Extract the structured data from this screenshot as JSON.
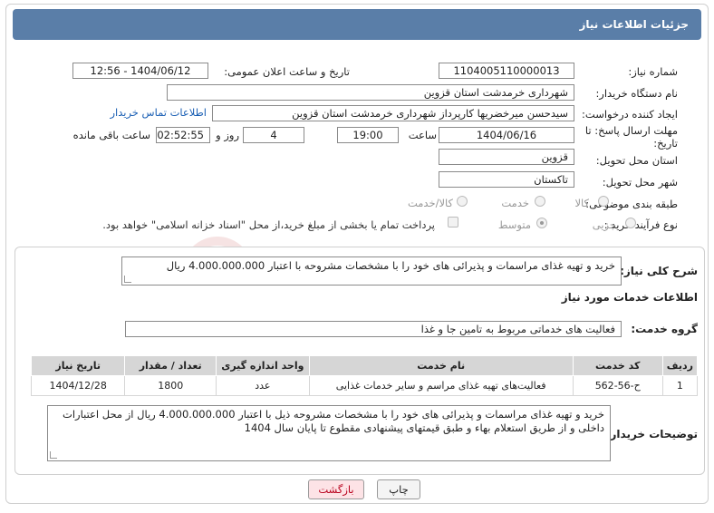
{
  "header": {
    "title": "جزئیات اطلاعات نیاز"
  },
  "fields": {
    "need_number_label": "شماره نیاز:",
    "need_number": "1104005110000013",
    "announce_label": "تاریخ و ساعت اعلان عمومی:",
    "announce_value": "1404/06/12 - 12:56",
    "buyer_org_label": "نام دستگاه خریدار:",
    "buyer_org": "شهرداری خرمدشت استان قزوین",
    "creator_label": "ایجاد کننده درخواست:",
    "creator": "سیدحسن میرخضریها کارپرداز شهرداری خرمدشت استان قزوین",
    "contact_link": "اطلاعات تماس خریدار",
    "deadline_label": "مهلت ارسال پاسخ: تا تاریخ:",
    "deadline_date": "1404/06/16",
    "hour_label": "ساعت",
    "deadline_time": "19:00",
    "days_value": "4",
    "days_label": "روز و",
    "remaining_time": "02:52:55",
    "remaining_label": "ساعت باقی مانده",
    "province_label": "استان محل تحویل:",
    "province": "قزوین",
    "city_label": "شهر محل تحویل:",
    "city": "تاکستان",
    "category_label": "طبقه بندی موضوعی:",
    "category_options": [
      "کالا",
      "خدمت",
      "کالا/خدمت"
    ],
    "process_label": "نوع فرآیند خرید :",
    "process_options": [
      "جزیی",
      "متوسط"
    ],
    "payment_note": "پرداخت تمام یا بخشی از مبلغ خرید،از محل \"اسناد خزانه اسلامی\" خواهد بود."
  },
  "summary": {
    "label": "شرح کلی نیاز:",
    "text": "خرید و تهیه غذای مراسمات و پذیرائی های خود را با مشخصات مشروحه با اعتبار 4.000.000.000 ریال"
  },
  "services": {
    "heading": "اطلاعات خدمات مورد نیاز",
    "group_label": "گروه خدمت:",
    "group_value": "فعالیت های خدماتی مربوط به تامین جا و غذا",
    "columns": [
      "ردیف",
      "کد خدمت",
      "نام خدمت",
      "واحد اندازه گیری",
      "تعداد / مقدار",
      "تاریخ نیاز"
    ],
    "rows": [
      [
        "1",
        "ح-56-562",
        "فعالیت‌های تهیه غذای مراسم و سایر خدمات غذایی",
        "عدد",
        "1800",
        "1404/12/28"
      ]
    ]
  },
  "buyer_notes": {
    "label": "توضیحات خریدار:",
    "text": "خرید و تهیه غذای مراسمات و پذیرائی های خود را با مشخصات مشروحه ذیل با اعتبار 4.000.000.000 ریال از محل اعتبارات داخلی و از طریق استعلام بهاء و طبق قیمتهای پیشنهادی مقطوع تا پایان سال 1404"
  },
  "buttons": {
    "print": "چاپ",
    "back": "بازگشت"
  },
  "watermark": {
    "text": "AriaTender.net"
  },
  "colors": {
    "header_bg": "#5a7ea8",
    "link": "#1a5fb4",
    "back_button_bg": "#fde3e6"
  }
}
